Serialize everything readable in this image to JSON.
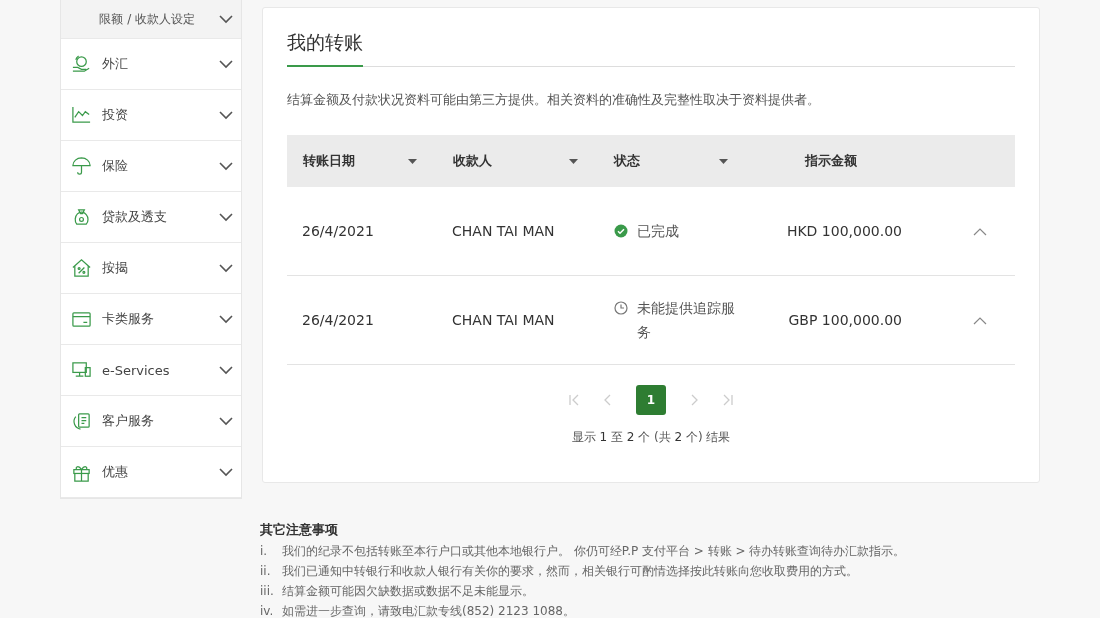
{
  "sidebar": {
    "items": [
      {
        "label": "限额 / 收款人设定",
        "kind": "sub"
      },
      {
        "label": "外汇",
        "kind": "main"
      },
      {
        "label": "投资",
        "kind": "main"
      },
      {
        "label": "保险",
        "kind": "main"
      },
      {
        "label": "贷款及透支",
        "kind": "main"
      },
      {
        "label": "按揭",
        "kind": "main"
      },
      {
        "label": "卡类服务",
        "kind": "main"
      },
      {
        "label": "e-Services",
        "kind": "main"
      },
      {
        "label": "客户服务",
        "kind": "main"
      },
      {
        "label": "优惠",
        "kind": "main"
      }
    ]
  },
  "card": {
    "title": "我的转账",
    "notice": "结算金额及付款状况资料可能由第三方提供。相关资料的准确性及完整性取决于资料提供者。",
    "table": {
      "columns": [
        {
          "label": "转账日期",
          "sortable": true
        },
        {
          "label": "收款人",
          "sortable": true
        },
        {
          "label": "状态",
          "sortable": true
        },
        {
          "label": "指示金额",
          "sortable": false
        }
      ],
      "rows": [
        {
          "date": "26/4/2021",
          "payee": "CHAN TAI MAN",
          "status": "已完成",
          "kind": "completed",
          "amount": "HKD 100,000.00"
        },
        {
          "date": "26/4/2021",
          "payee": "CHAN TAI MAN",
          "status": "未能提供追踪服务",
          "kind": "pending",
          "amount": "GBP 100,000.00"
        }
      ]
    },
    "pagination": {
      "pages": [
        {
          "label": "1",
          "selected": true
        }
      ],
      "summary": "显示 **1** 至 **2** 个 (共 **2** 个) 结果"
    }
  },
  "notes": {
    "title": "其它注意事项",
    "items": [
      {
        "marker": "i.",
        "text": "我们的纪录不包括转账至本行户口或其他本地银行户。 你仍可经P.P 支付平台 > 转账 > 待办转账查询待办汇款指示。"
      },
      {
        "marker": "ii.",
        "text": "我们已通知中转银行和收款人银行有关你的要求，然而，相关银行可酌情选择按此转账向您收取费用的方式。"
      },
      {
        "marker": "iii.",
        "text": "结算金额可能因欠缺数据或数据不足未能显示。"
      },
      {
        "marker": "iv.",
        "text": "如需进一步查询，请致电汇款专线(852) 2123 1088。"
      }
    ]
  }
}
